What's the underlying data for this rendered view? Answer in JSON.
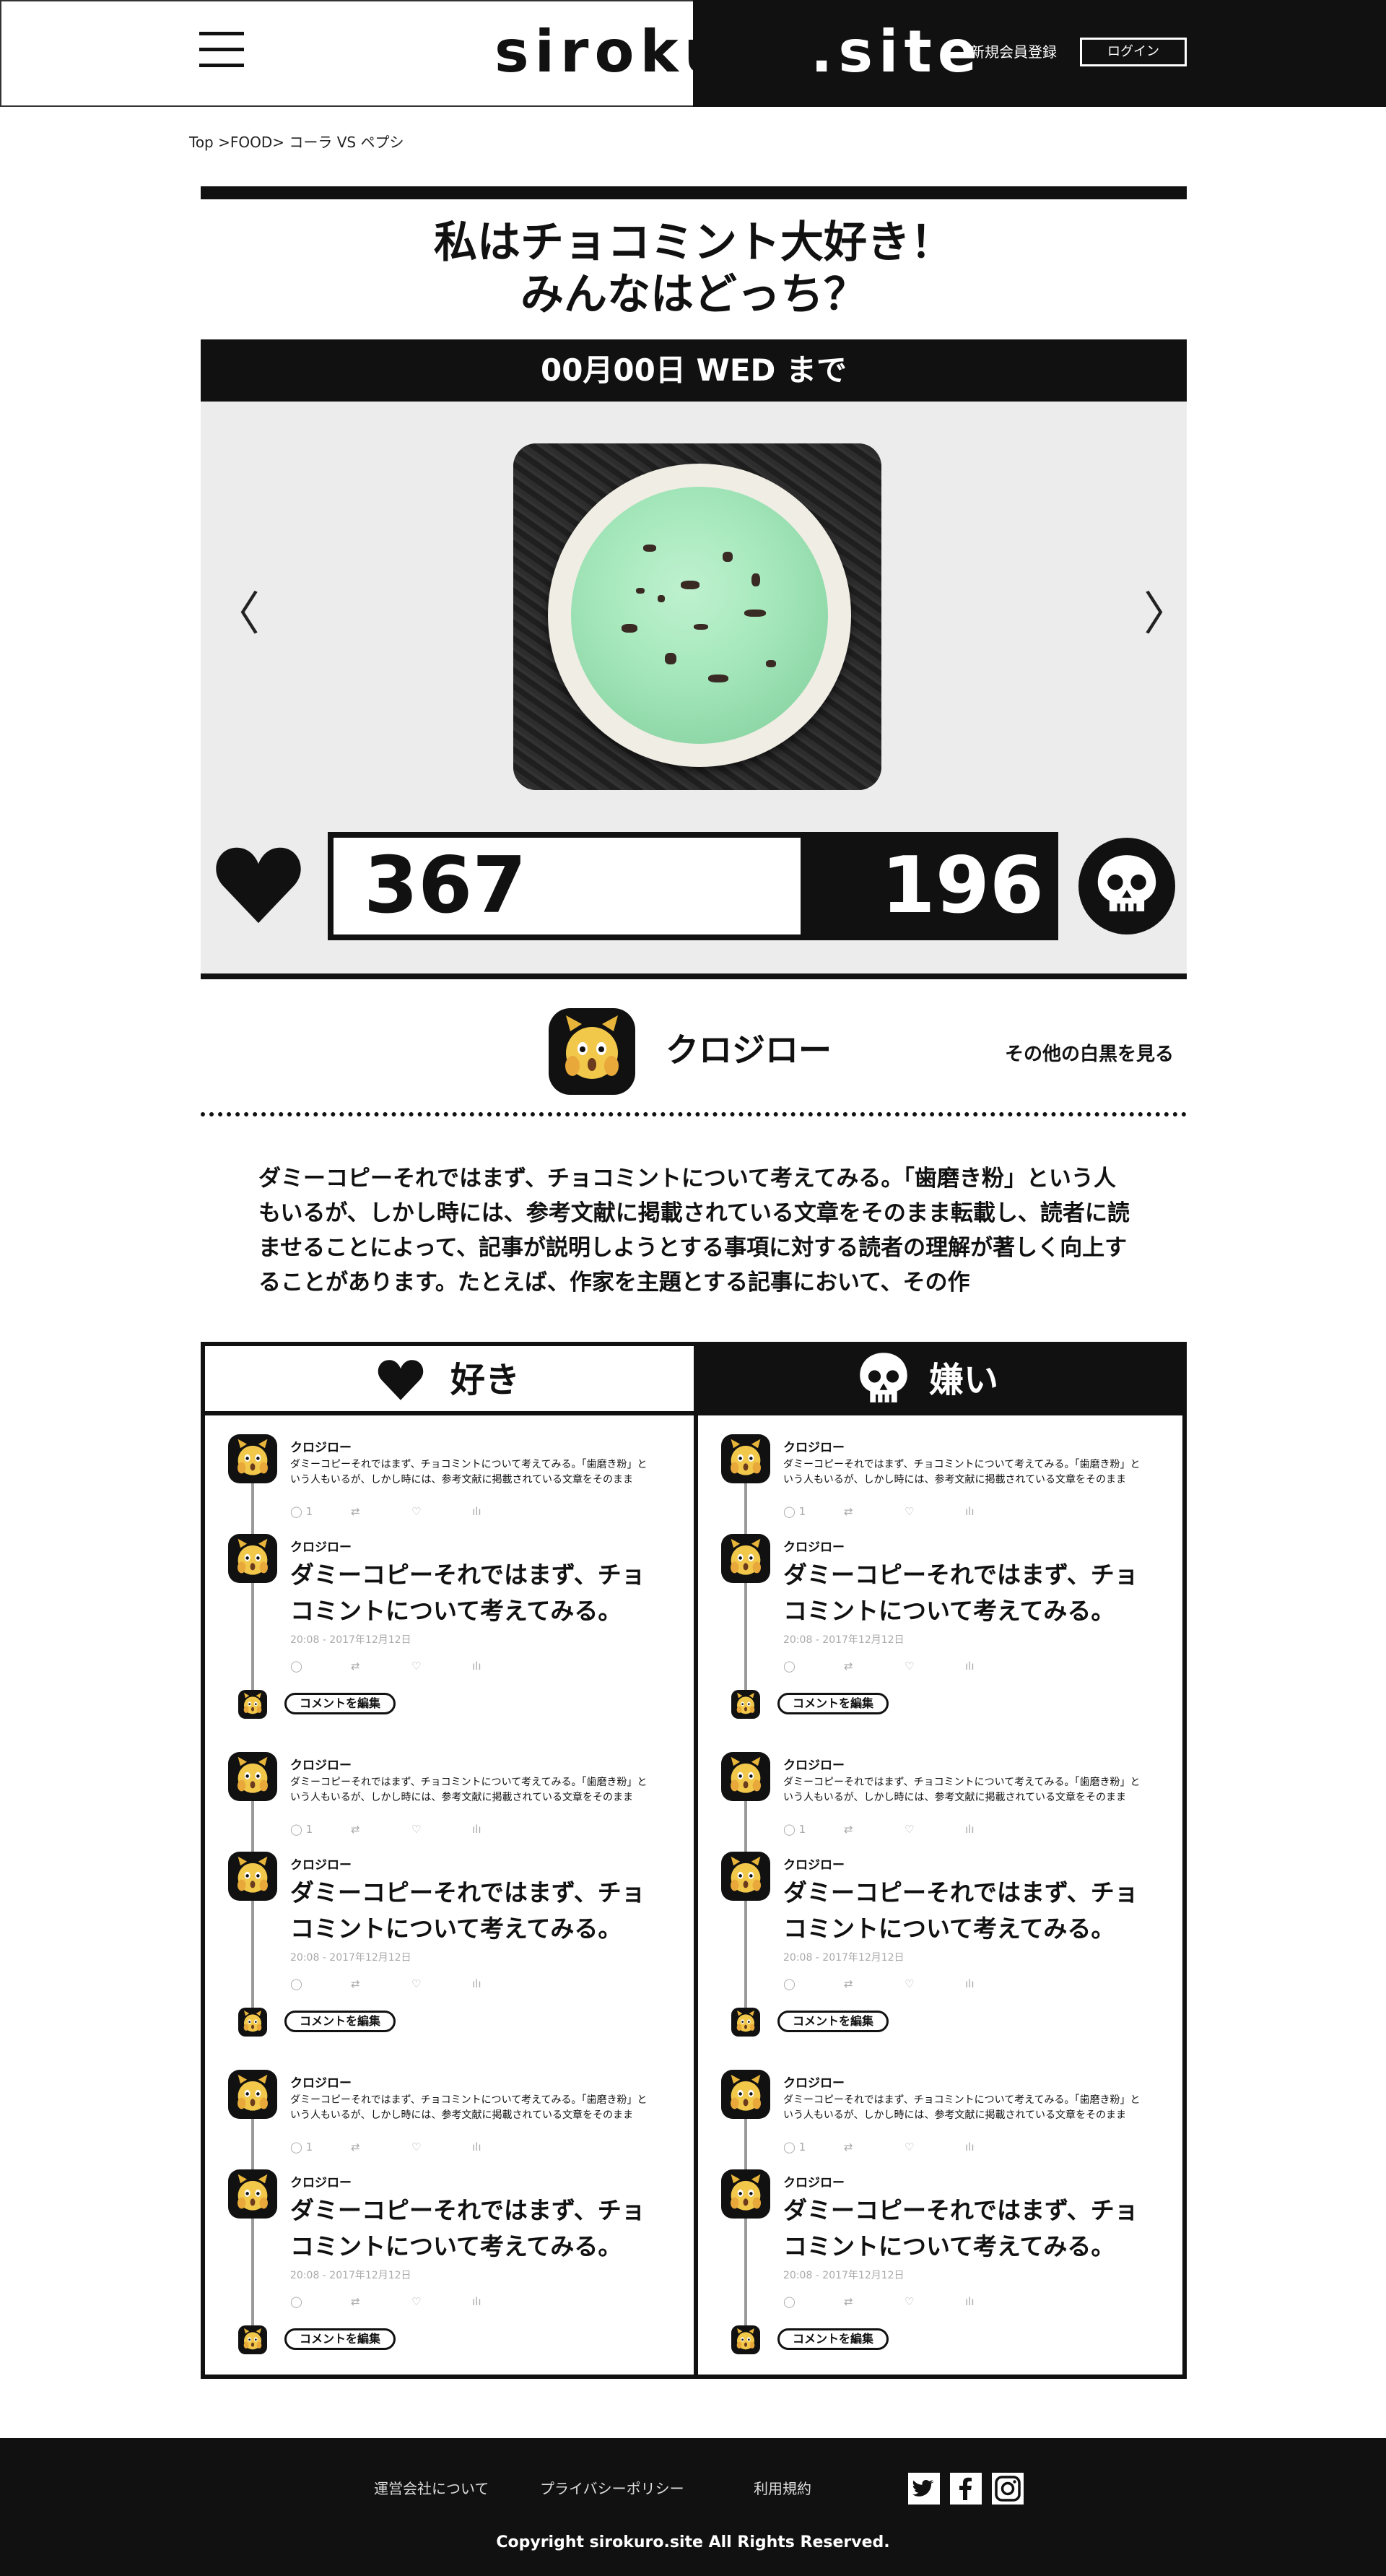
{
  "header": {
    "logo_dark": "sirokuro",
    "logo_light": ".site",
    "signup_label": "新規会員登録",
    "login_label": "ログイン"
  },
  "breadcrumb": "Top >FOOD> コーラ VS ペプシ",
  "topic": {
    "title_line1": "私はチョコミント大好き！",
    "title_line2": "みんなはどっち？",
    "deadline": "00月00日 WED まで",
    "image_alt": "チョコミントアイス"
  },
  "votes": {
    "like_count": "367",
    "dislike_count": "196",
    "like_ratio": 0.65
  },
  "author": {
    "name": "クロジロー",
    "more_label": "その他の白黒を見る"
  },
  "description": "ダミーコピーそれではまず、チョコミントについて考えてみる。「歯磨き粉」という人もいるが、しかし時には、参考文献に掲載されている文章をそのまま転載し、読者に読ませることによって、記事が説明しようとする事項に対する読者の理解が著しく向上することがあります。たとえば、作家を主題とする記事において、その作",
  "columns": {
    "like_label": "好き",
    "dislike_label": "嫌い"
  },
  "thread": {
    "name": "クロジロー",
    "text1": "ダミーコピーそれではまず、チョコミントについて考えてみる。「歯磨き粉」という人もいるが、しかし時には、参考文献に掲載されている文章をそのまま",
    "reply_count": "1",
    "text2": "ダミーコピーそれではまず、チョコミントについて考えてみる。",
    "date": "20:08 - 2017年12月12日",
    "edit_label": "コメントを編集"
  },
  "footer": {
    "link_company": "運営会社について",
    "link_privacy": "プライバシーポリシー",
    "link_terms": "利用規約",
    "copyright": "Copyright sirokuro.site All Rights Reserved."
  },
  "icons": [
    "hamburger-icon",
    "chevron-left-icon",
    "chevron-right-icon",
    "heart-icon",
    "skull-icon",
    "reply-icon",
    "retweet-icon",
    "like-icon",
    "stats-icon",
    "twitter-icon",
    "facebook-icon",
    "instagram-icon"
  ]
}
